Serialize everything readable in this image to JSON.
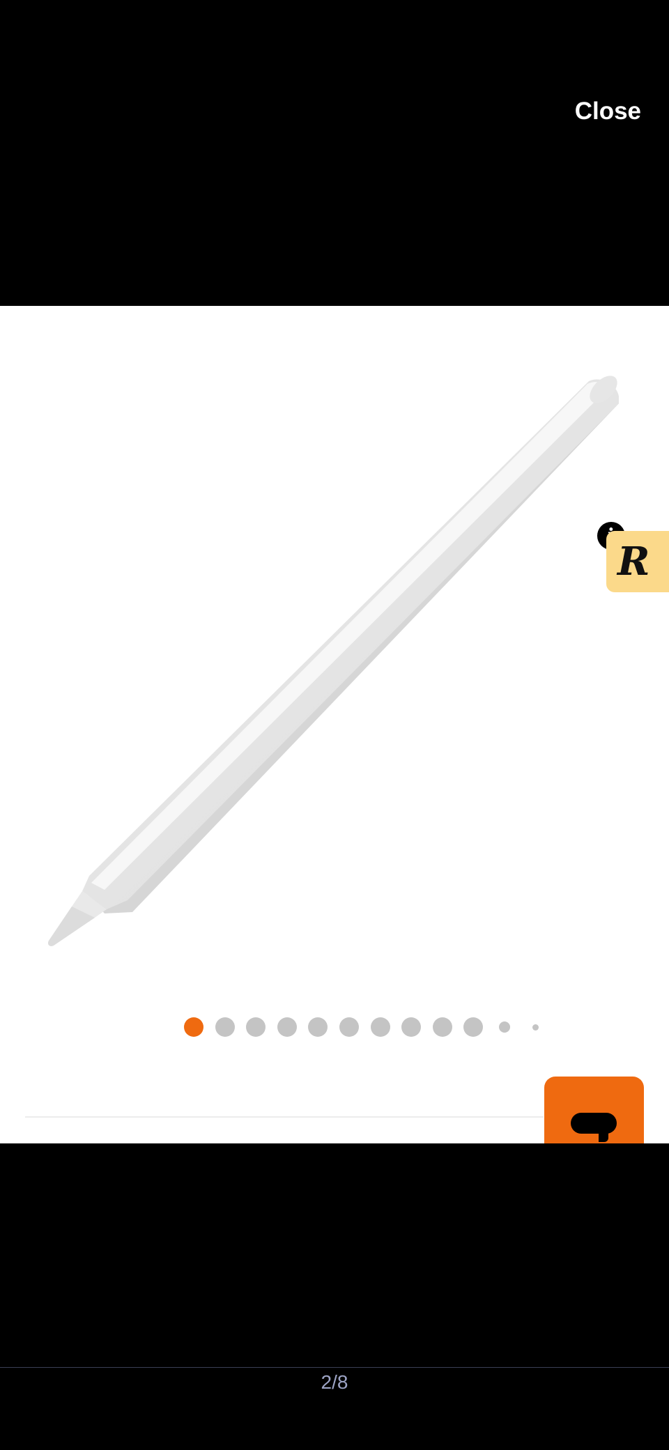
{
  "header": {
    "close_label": "Close"
  },
  "gallery": {
    "image_icon": "stylus-pencil-image",
    "dots_total": 12,
    "active_dot": 1,
    "active_color": "#ef6a10",
    "inactive_color": "#c4c4c4"
  },
  "rewards_widget": {
    "letter": "R",
    "info_glyph": "i",
    "bg_color": "#fbd98a"
  },
  "chat": {
    "icon": "chat-bubble-icon",
    "bg_color": "#ef6a10"
  },
  "pager": {
    "counter": "2/8"
  }
}
